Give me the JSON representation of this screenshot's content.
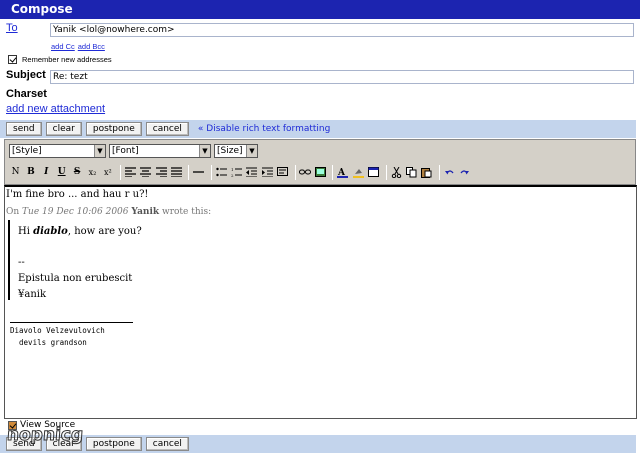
{
  "window": {
    "title": "Compose"
  },
  "to": {
    "label": "To",
    "value": "Yanik <lol@nowhere.com>"
  },
  "cc_links": {
    "add_cc": "add Cc",
    "add_bcc": "add Bcc"
  },
  "remember": {
    "label": "Remember new addresses",
    "checked": true
  },
  "subject": {
    "label": "Subject",
    "value": "Re: tezt"
  },
  "charset": {
    "label": "Charset"
  },
  "attachment": {
    "label": "add new attachment"
  },
  "actions": {
    "send": "send",
    "clear": "clear",
    "postpone": "postpone",
    "cancel": "cancel"
  },
  "disable_rich": "« Disable rich text formatting",
  "toolbar": {
    "style_select": "[Style]",
    "font_select": "[Font]",
    "size_select": "[Size]",
    "buttons": [
      {
        "name": "normal-button",
        "glyph": "N"
      },
      {
        "name": "bold-button",
        "glyph": "B"
      },
      {
        "name": "italic-button",
        "glyph": "I"
      },
      {
        "name": "underline-button",
        "glyph": "U"
      },
      {
        "name": "strikethrough-button",
        "glyph": "S"
      },
      {
        "name": "subscript-button",
        "glyph": "x₂"
      },
      {
        "name": "superscript-button",
        "glyph": "x²"
      }
    ]
  },
  "body": {
    "line1": "I'm fine bro ... and hau r u?!",
    "wrote_prefix": "On ",
    "wrote_date": "Tue 19 Dec 10:06 2006",
    "wrote_name": "Yanik",
    "wrote_suffix": " wrote this:",
    "quote_hi": "Hi ",
    "quote_name": "diablo",
    "quote_rest": ", how are you?",
    "quote_dash": "--",
    "quote_motto": "Epistula non erubescit",
    "quote_sig": "¥anik",
    "sig_line1": "Diavolo Velzevulovich",
    "sig_line2": "  devils grandson"
  },
  "view_source": {
    "label": "View Source"
  },
  "watermark": "nopnicg",
  "colors": {
    "titlebar": "#1c24b0",
    "buttonbar": "#c3d4ec",
    "link": "#1f2bd6"
  }
}
